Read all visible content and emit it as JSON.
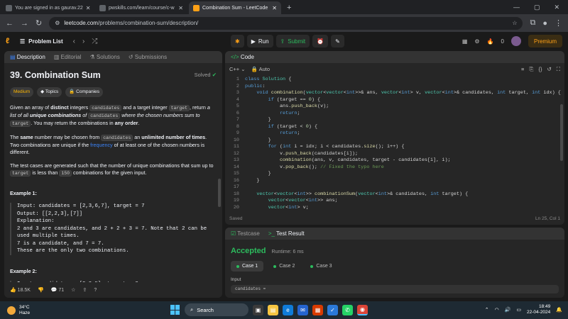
{
  "browser": {
    "tabs": [
      {
        "title": "You are signed in as gaurav.22",
        "active": false
      },
      {
        "title": "pwskills.com/learn/course/c-w",
        "active": false
      },
      {
        "title": "Combination Sum - LeetCode",
        "active": true
      }
    ],
    "url_domain": "leetcode.com",
    "url_path": "/problems/combination-sum/description/"
  },
  "nav": {
    "problem_list": "Problem List",
    "run": "Run",
    "submit": "Submit",
    "coins": "0",
    "premium": "Premium"
  },
  "description": {
    "tabs": [
      "Description",
      "Editorial",
      "Solutions",
      "Submissions"
    ],
    "title": "39. Combination Sum",
    "status": "Solved",
    "tags": [
      "Medium",
      "Topics",
      "Companies"
    ],
    "p1_a": "Given an array of ",
    "p1_b": "distinct",
    "p1_c": " integers ",
    "p1_code1": "candidates",
    "p1_d": " and a target integer ",
    "p1_code2": "target",
    "p1_e": ", return ",
    "p1_f": "a list of all ",
    "p1_g": "unique combinations",
    "p1_h": " of ",
    "p1_code3": "candidates",
    "p1_i": " where the chosen numbers sum to ",
    "p1_code4": "target",
    "p1_j": ". You may return the combinations in ",
    "p1_k": "any order",
    "p1_l": ".",
    "p2_a": "The ",
    "p2_b": "same",
    "p2_c": " number may be chosen from ",
    "p2_code": "candidates",
    "p2_d": " an ",
    "p2_e": "unlimited number of times",
    "p2_f": ". Two combinations are unique if the ",
    "p2_link": "frequency",
    "p2_g": " of at least one of the chosen numbers is different.",
    "p3_a": "The test cases are generated such that the number of unique combinations that sum up to ",
    "p3_code1": "target",
    "p3_b": " is less than ",
    "p3_code2": "150",
    "p3_c": " combinations for the given input.",
    "ex1_title": "Example 1:",
    "ex1_body": "Input: candidates = [2,3,6,7], target = 7\nOutput: [[2,2,3],[7]]\nExplanation:\n2 and 3 are candidates, and 2 + 2 + 3 = 7. Note that 2 can be used multiple times.\n7 is a candidate, and 7 = 7.\nThese are the only two combinations.",
    "ex2_title": "Example 2:",
    "ex2_body": "Input: candidates = [2,3,5], target = 8",
    "likes": "18.5K",
    "comments": "71"
  },
  "code": {
    "title": "Code",
    "language": "C++",
    "mode": "Auto",
    "lines": [
      {
        "n": "1",
        "t": "class Solution {"
      },
      {
        "n": "2",
        "t": "public:"
      },
      {
        "n": "3",
        "t": "    void combination(vector<vector<int>>& ans, vector<int> v, vector<int>& candidates, int target, int idx) {"
      },
      {
        "n": "4",
        "t": "        if (target == 0) {"
      },
      {
        "n": "5",
        "t": "            ans.push_back(v);"
      },
      {
        "n": "6",
        "t": "            return;"
      },
      {
        "n": "7",
        "t": "        }"
      },
      {
        "n": "8",
        "t": "        if (target < 0) {"
      },
      {
        "n": "9",
        "t": "            return;"
      },
      {
        "n": "10",
        "t": "        }"
      },
      {
        "n": "11",
        "t": "        for (int i = idx; i < candidates.size(); i++) {"
      },
      {
        "n": "12",
        "t": "            v.push_back(candidates[i]);"
      },
      {
        "n": "13",
        "t": "            combination(ans, v, candidates, target - candidates[i], i);"
      },
      {
        "n": "14",
        "t": "            v.pop_back(); // Fixed the typo here"
      },
      {
        "n": "15",
        "t": "        }"
      },
      {
        "n": "16",
        "t": "    }"
      },
      {
        "n": "17",
        "t": ""
      },
      {
        "n": "18",
        "t": "    vector<vector<int>> combinationSum(vector<int>& candidates, int target) {"
      },
      {
        "n": "19",
        "t": "        vector<vector<int>> ans;"
      },
      {
        "n": "20",
        "t": "        vector<int> v;"
      }
    ],
    "saved": "Saved",
    "position": "Ln 25, Col 1"
  },
  "result": {
    "tabs": [
      "Testcase",
      "Test Result"
    ],
    "status": "Accepted",
    "runtime": "Runtime: 6 ms",
    "cases": [
      "Case 1",
      "Case 2",
      "Case 3"
    ],
    "input_label": "Input",
    "input_value": "candidates ="
  },
  "taskbar": {
    "temp": "34°C",
    "weather": "Haze",
    "search": "Search",
    "time": "18:49",
    "date": "22-04-2024"
  }
}
